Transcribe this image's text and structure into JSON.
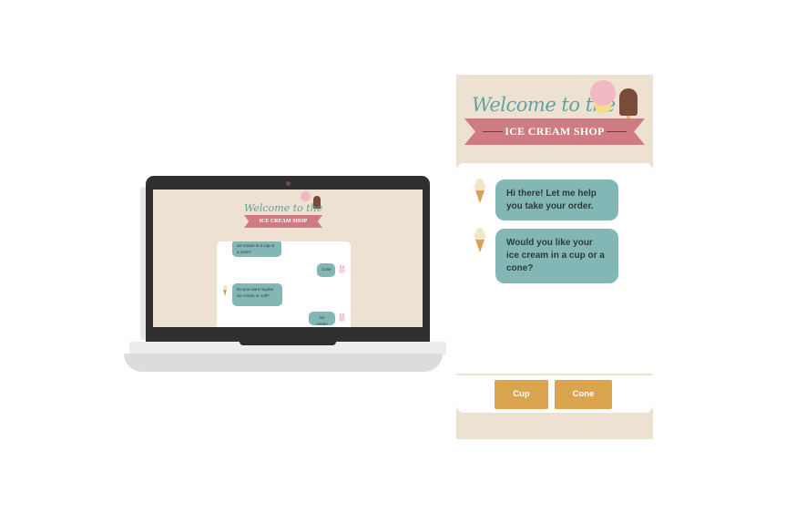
{
  "header": {
    "welcome": "Welcome to the",
    "banner": "ICE CREAM SHOP"
  },
  "chat": {
    "messages": [
      {
        "from": "bot",
        "text": "Hi there! Let me help you take your order."
      },
      {
        "from": "bot",
        "text": "Would you like your ice cream in a cup or a cone?"
      }
    ],
    "options": [
      "Cup",
      "Cone"
    ]
  },
  "laptop_preview": {
    "welcome": "Welcome to the",
    "banner": "ICE CREAM SHOP",
    "messages": [
      {
        "from": "bot",
        "text": "ice cream in a cup or a cone?"
      },
      {
        "from": "user",
        "text": "Cone"
      },
      {
        "from": "bot",
        "text": "Do you want regular ice cream or soft?"
      },
      {
        "from": "user",
        "text": "Ice cream"
      }
    ]
  },
  "colors": {
    "panel_bg": "#ede1d1",
    "teal": "#82b7b5",
    "banner_pink": "#cf7b82",
    "button": "#dba550",
    "title_teal": "#5fa3a3"
  },
  "icons": [
    "ice-cream-cone-icon",
    "bunny-icon",
    "ice-cream-scoop-icon",
    "popsicle-icon"
  ]
}
